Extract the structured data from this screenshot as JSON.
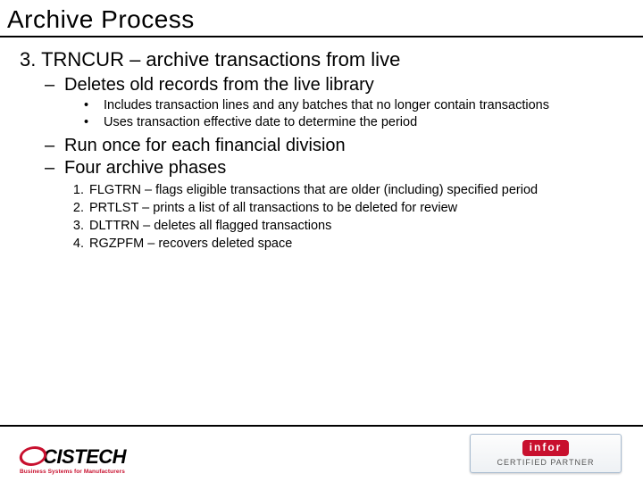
{
  "title": "Archive Process",
  "main": {
    "number": "3.",
    "heading": "TRNCUR – archive transactions from live"
  },
  "sub1": {
    "dash": "–",
    "text": "Deletes old records from the live library"
  },
  "bullets": [
    "Includes transaction lines and any batches that no longer contain transactions",
    "Uses transaction effective date to determine the period"
  ],
  "sub2": {
    "dash": "–",
    "text": "Run once for each financial division"
  },
  "sub3": {
    "dash": "–",
    "text": "Four archive phases"
  },
  "phases": [
    "FLGTRN – flags eligible transactions that are older (including) specified period",
    "PRTLST – prints a list of all transactions to be deleted for review",
    "DLTTRN – deletes all flagged transactions",
    "RGZPFM – recovers deleted space"
  ],
  "footer": {
    "left_brand": "CISTECH",
    "left_tag": "Business Systems for Manufacturers",
    "right_brand": "infor",
    "right_sub": "CERTIFIED PARTNER"
  }
}
